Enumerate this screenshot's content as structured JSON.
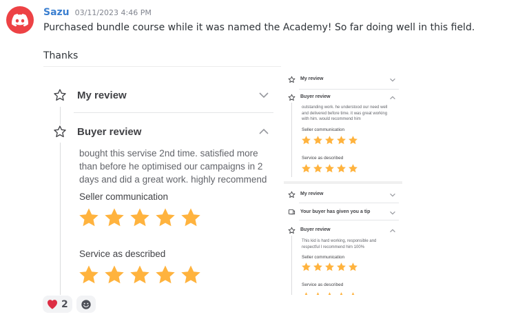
{
  "message": {
    "author": "Sazu",
    "timestamp": "03/11/2023 4:46 PM",
    "line1": "Purchased bundle course while it was named the Academy! So far doing well in this field.",
    "line2": "Thanks",
    "avatar_color": "#ed4245",
    "author_color": "#3b7fd0"
  },
  "left_screenshot": {
    "my_review": "My review",
    "buyer_review": "Buyer review",
    "review_text": "bought this servise 2nd time. satisfied more than before he optimised our campaigns in 2 days and did a great work. highly recommend",
    "seller_communication": "Seller communication",
    "service_as_described": "Service as described",
    "seller_communication_rating": 5,
    "service_as_described_rating": 5
  },
  "right_top": {
    "my_review": "My review",
    "buyer_review": "Buyer review",
    "review_text": "outstanding work. he understood our need well and delivered before time. it was great working with him. would recommend him",
    "seller_communication": "Seller communication",
    "service_as_described": "Service as described",
    "seller_communication_rating": 5,
    "service_as_described_rating": 5
  },
  "right_bottom": {
    "my_review": "My review",
    "tip": "Your buyer has given you a tip",
    "buyer_review": "Buyer review",
    "review_text": "This kid is hard working, responsible and respectful I recommend him 100%",
    "seller_communication": "Seller communication",
    "service_as_described": "Service as described",
    "seller_communication_rating": 5
  },
  "reactions": [
    {
      "icon": "heart-icon",
      "count": "2"
    },
    {
      "icon": "add-reaction-icon",
      "count": ""
    }
  ],
  "colors": {
    "star": "#ffb33e",
    "heart": "#dd2e44"
  }
}
